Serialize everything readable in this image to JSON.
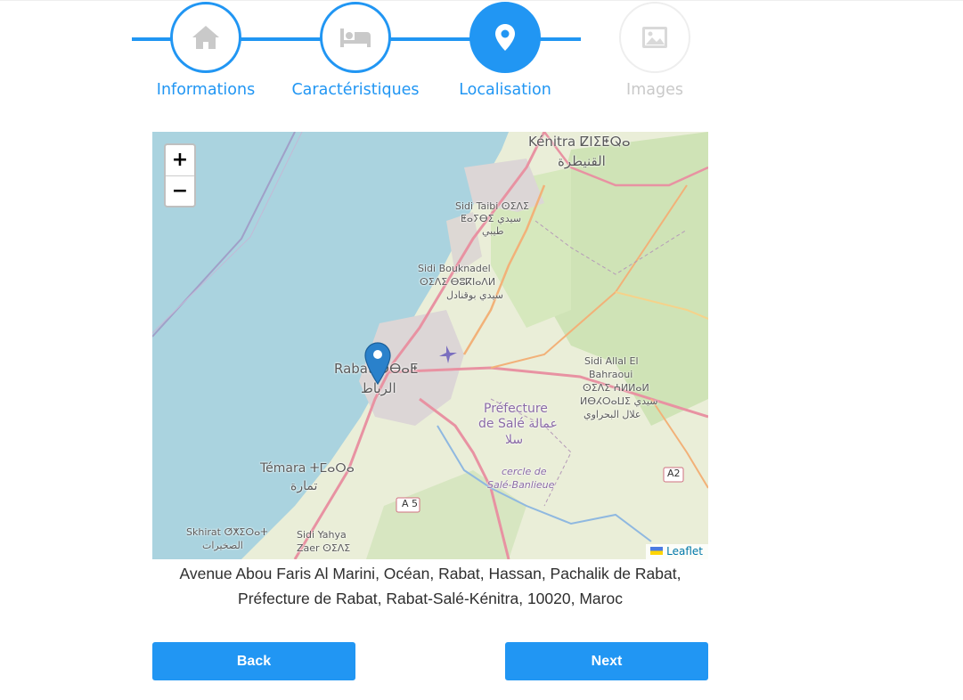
{
  "stepper": {
    "steps": [
      {
        "label": "Informations",
        "icon": "home-icon",
        "state": "done"
      },
      {
        "label": "Caractéristiques",
        "icon": "bed-icon",
        "state": "done"
      },
      {
        "label": "Localisation",
        "icon": "map-pin-icon",
        "state": "active"
      },
      {
        "label": "Images",
        "icon": "image-icon",
        "state": "disabled"
      }
    ],
    "accent_color": "#2196f3",
    "disabled_color": "#c9c9c9"
  },
  "map": {
    "zoom_in_label": "+",
    "zoom_out_label": "−",
    "attribution": "Leaflet",
    "places": {
      "kenitra_latin": "Kénitra ⵇⵏⵉⵟⵕⴰ",
      "kenitra_ar": "القنيطرة",
      "sidi_taibi_1": "Sidi Taibi ⵙⵉⴷⵉ",
      "sidi_taibi_2": "ⵟⴰⵢⴱⵉ سيدي",
      "sidi_taibi_3": "طيبي",
      "sidi_bouknadel_1": "Sidi Bouknadel",
      "sidi_bouknadel_2": "ⵙⵉⴷⵉ ⴱⵓⴽⵏⴰⴷⵍ",
      "sidi_bouknadel_3": "سيدي بوقنادل",
      "rabat_latin": "Rabat ⵔⴱⴰⵟ",
      "rabat_ar": "الرباط",
      "sidi_allal_1": "Sidi Allal El",
      "sidi_allal_2": "Bahraoui",
      "sidi_allal_3": "ⵙⵉⴷⵉ ⵄⵍⵍⴰⵍ",
      "sidi_allal_4": "ⵍⴱⵃⵔⴰⵡⵉ سيدي",
      "sidi_allal_5": "علال البحراوي",
      "prefecture_sale_1": "Préfecture",
      "prefecture_sale_2": "de Salé عمالة",
      "prefecture_sale_3": "سلا",
      "cercle_1": "cercle de",
      "cercle_2": "Salé-Banlieue",
      "temara_latin": "Témara ⵜⵎⴰⵔⴰ",
      "temara_ar": "تمارة",
      "skhirat": "Skhirat ⵚⵅⵉⵔⴰⵜ",
      "skhirat_ar": "الصخيرات",
      "sidi_yahya_1": "Sidi Yahya",
      "sidi_yahya_2": "Zaer ⵙⵉⴷⵉ",
      "road_a5": "A 5",
      "road_a2": "A2"
    }
  },
  "address": {
    "line1": "Avenue Abou Faris Al Marini, Océan, Rabat, Hassan, Pachalik de Rabat,",
    "line2": "Préfecture de Rabat, Rabat-Salé-Kénitra, 10020, Maroc"
  },
  "buttons": {
    "back": "Back",
    "next": "Next"
  }
}
